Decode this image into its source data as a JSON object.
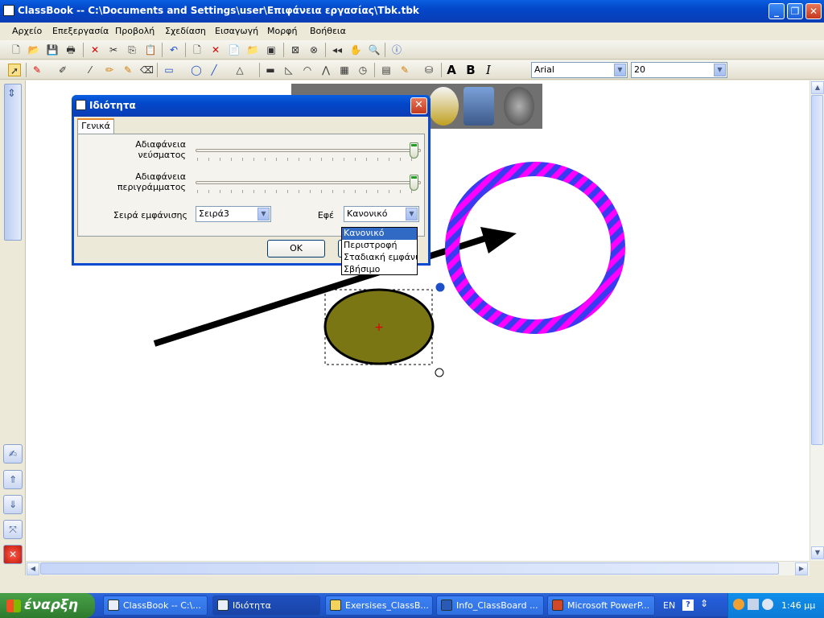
{
  "window": {
    "title": "ClassBook -- C:\\Documents and Settings\\user\\Επιφάνεια εργασίας\\Tbk.tbk",
    "min_label": "_",
    "max_label": "❐",
    "close_label": "✕"
  },
  "menu": [
    "Αρχείο",
    "Επεξεργασία",
    "Προβολή",
    "Σχεδίαση",
    "Εισαγωγή",
    "Μορφή",
    "Βοήθεια"
  ],
  "toolbar": {
    "font_name": "Arial",
    "font_size": "20",
    "bold_label": "B",
    "italic_label": "I",
    "text_label": "A"
  },
  "dialog": {
    "title": "Ιδιότητα",
    "close_label": "✕",
    "tab": "Γενικά",
    "opacity_label": "Αδιαφάνεια νεύσματος",
    "opacity_value": 1.0,
    "fill_label": "Αδιαφάνεια περιγράμματος",
    "fill_value": 1.0,
    "order_label": "Σειρά εμφάνισης",
    "order_value": "Σειρά3",
    "effect_label": "Εφέ",
    "effect_value": "Κανονικό",
    "effect_options": [
      "Κανονικό",
      "Περιστροφή",
      "Σταδιακή εμφάνιση",
      "Σβήσιμο"
    ],
    "ok_label": "OK"
  },
  "colors": {
    "ellipse_fill": "#7a7614",
    "ring_primary": "#ff00ff",
    "ring_secondary": "#3a3af0",
    "arrow": "#000000"
  },
  "taskbar": {
    "start": "έναρξη",
    "tasks": [
      "ClassBook -- C:\\...",
      "Ιδιότητα",
      "Exersises_ClassB...",
      "Info_ClassBoard ...",
      "Microsoft PowerP..."
    ],
    "lang": "EN",
    "time": "1:46 μμ"
  }
}
